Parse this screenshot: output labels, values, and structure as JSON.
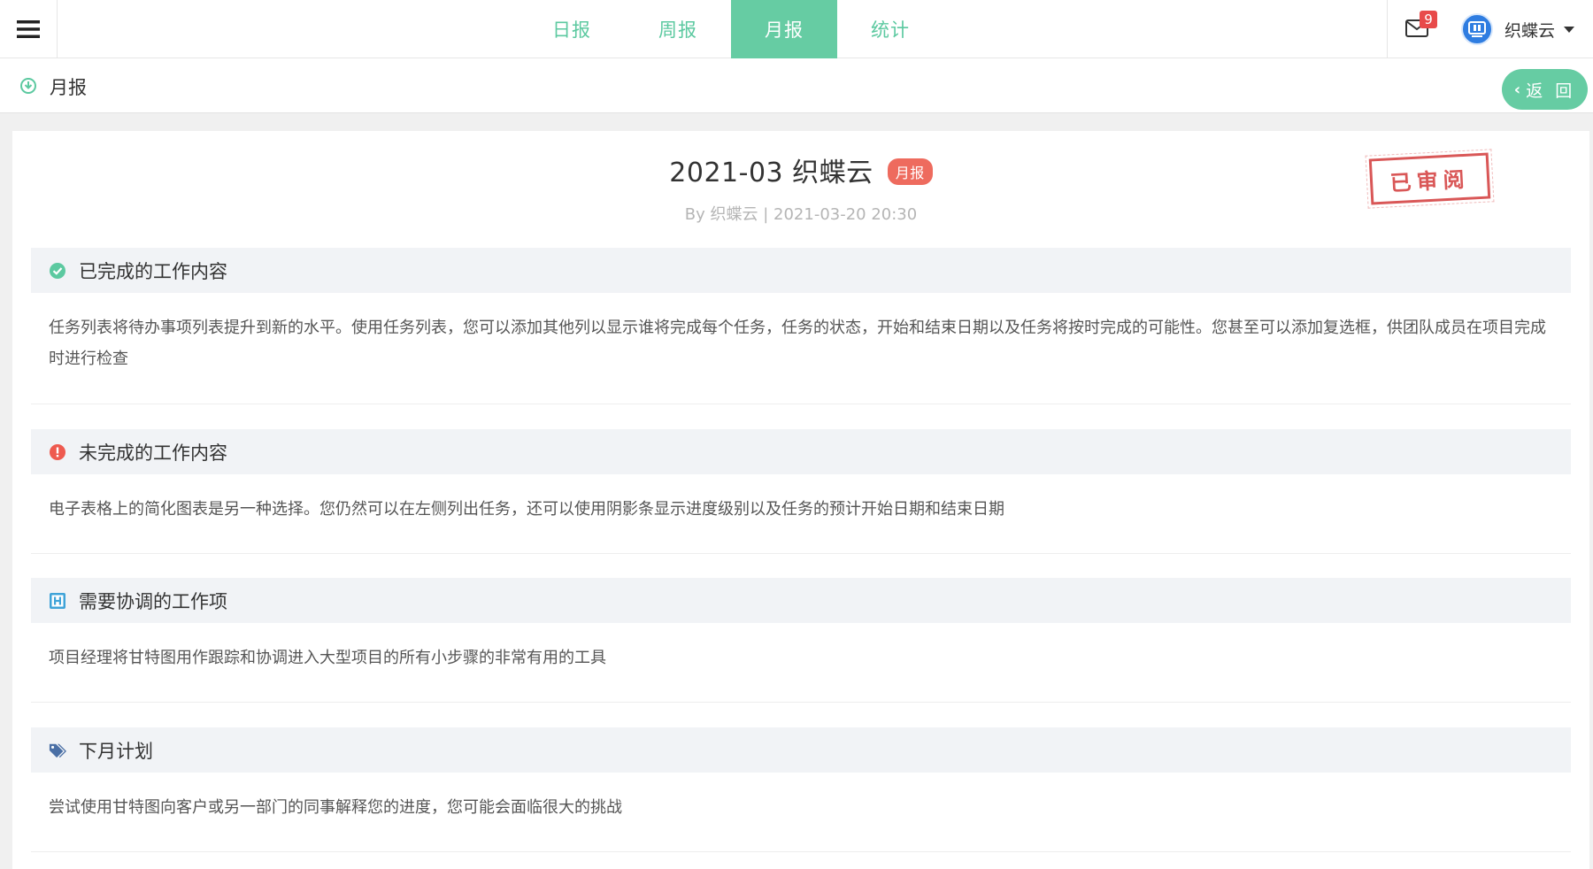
{
  "nav": {
    "tabs": [
      {
        "label": "日报"
      },
      {
        "label": "周报"
      },
      {
        "label": "月报",
        "active": true
      },
      {
        "label": "统计"
      }
    ],
    "accent_color": "#66cca3"
  },
  "user": {
    "mail_count": "9",
    "name": "织蝶云",
    "avatar_text": "织蝶云"
  },
  "subheader": {
    "title": "月报",
    "back_label": "返 回"
  },
  "report": {
    "title": "2021-03 织蝶云",
    "tag": "月报",
    "meta": "By 织蝶云 | 2021-03-20 20:30",
    "stamp": "已审阅"
  },
  "sections": [
    {
      "icon": "check-circle-icon",
      "title": "已完成的工作内容",
      "body": "任务列表将待办事项列表提升到新的水平。使用任务列表，您可以添加其他列以显示谁将完成每个任务，任务的状态，开始和结束日期以及任务将按时完成的可能性。您甚至可以添加复选框，供团队成员在项目完成时进行检查"
    },
    {
      "icon": "exclamation-circle-icon",
      "title": "未完成的工作内容",
      "body": "电子表格上的简化图表是另一种选择。您仍然可以在左侧列出任务，还可以使用阴影条显示进度级别以及任务的预计开始日期和结束日期"
    },
    {
      "icon": "h-square-icon",
      "title": "需要协调的工作项",
      "body": "项目经理将甘特图用作跟踪和协调进入大型项目的所有小步骤的非常有用的工具"
    },
    {
      "icon": "tags-icon",
      "title": "下月计划",
      "body": "尝试使用甘特图向客户或另一部门的同事解释您的进度，您可能会面临很大的挑战"
    }
  ]
}
